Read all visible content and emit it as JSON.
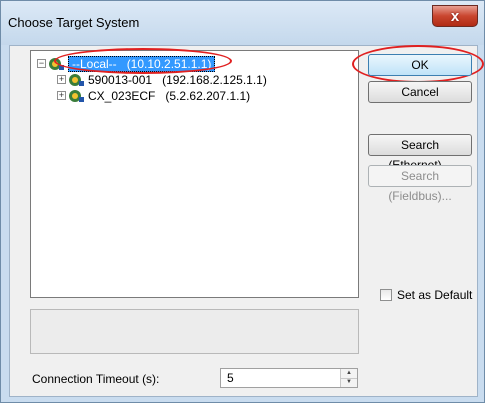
{
  "window": {
    "title": "Choose Target System",
    "close_label": "x"
  },
  "tree": {
    "items": [
      {
        "name": "--Local--",
        "address": "(10.10.2.51.1.1)",
        "selected": true
      },
      {
        "name": "590013-001",
        "address": "(192.168.2.125.1.1)",
        "selected": false
      },
      {
        "name": "CX_023ECF",
        "address": "(5.2.62.207.1.1)",
        "selected": false
      }
    ]
  },
  "buttons": {
    "ok": "OK",
    "cancel": "Cancel",
    "search_ethernet": "Search (Ethernet)...",
    "search_fieldbus": "Search (Fieldbus)..."
  },
  "set_as_default": {
    "label": "Set as Default",
    "checked": false
  },
  "connection_timeout": {
    "label": "Connection Timeout (s):",
    "value": "5"
  },
  "colors": {
    "selection": "#3399ff",
    "highlight_annotation": "#e02020"
  },
  "icons": [
    "close-icon",
    "network-icon",
    "expand-icon",
    "spin-up-icon",
    "spin-down-icon"
  ]
}
